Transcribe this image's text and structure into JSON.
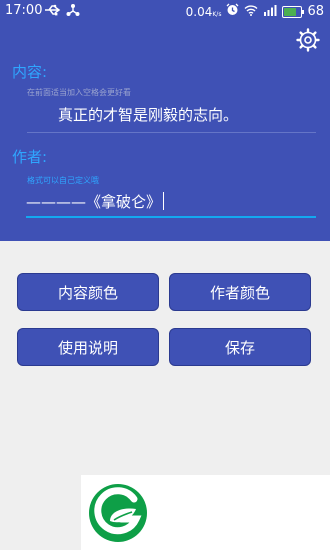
{
  "status_bar": {
    "time": "17:00",
    "left_icons": [
      "usb-icon",
      "share-icon"
    ],
    "data_rate": "0.04",
    "data_unit": "K/s",
    "right_icons": [
      "alarm-icon",
      "wifi-icon",
      "signal-icon"
    ],
    "battery": "68"
  },
  "colors": {
    "header": "#3f51b5",
    "accent": "#2fa6ff",
    "input_underline": "#13a8f0",
    "brand_green": "#0e9f47"
  },
  "content": {
    "label": "内容:",
    "hint": "在前面适当加入空格会更好看",
    "text": "真正的才智是刚毅的志向。"
  },
  "author": {
    "label": "作者:",
    "hint": "格式可以自己定义哦",
    "value": "————《拿破仑》"
  },
  "buttons": {
    "content_color": "内容颜色",
    "author_color": "作者颜色",
    "instructions": "使用说明",
    "save": "保存"
  }
}
